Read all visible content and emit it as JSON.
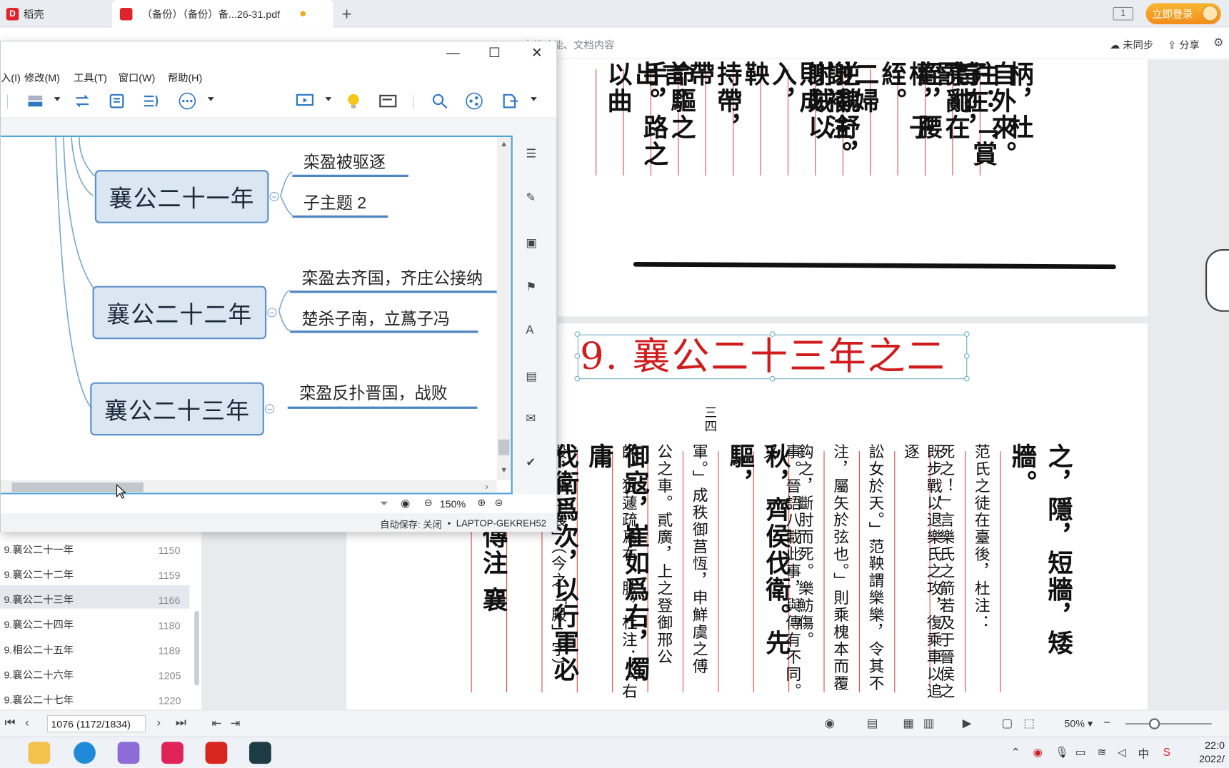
{
  "reader": {
    "home_tab": "稻壳",
    "doc_tab": "（备份）（备份）备...26-31.pdf",
    "login_button": "立即登录",
    "search_hint": "查找功能、文档内容",
    "sync_label": "未同步",
    "share_label": "分享",
    "heading": "9. 襄公二十三年之二",
    "page_input": "1076 (1172/1834)",
    "zoom_level": "50%",
    "toc": [
      {
        "title": "9.襄公二十年",
        "page": "1147"
      },
      {
        "title": "9.襄公二十一年",
        "page": "1150"
      },
      {
        "title": "9.襄公二十二年",
        "page": "1159"
      },
      {
        "title": "9.襄公二十三年",
        "page": "1166"
      },
      {
        "title": "9.襄公二十四年",
        "page": "1180"
      },
      {
        "title": "9.相公二十五年",
        "page": "1189"
      },
      {
        "title": "9.襄公二十六年",
        "page": "1205"
      },
      {
        "title": "9.襄公二十七年",
        "page": "1220"
      }
    ],
    "scan_top": [
      "自外來。",
      "子在",
      "柄，杜注：「賞罰",
      "亮亂在權，子",
      "首巾，絰，腰絰。",
      "二婦",
      "謝補注。",
      "逆魏舒，則成",
      "謝賊以入，",
      "鞅",
      "持帶，",
      "帶",
      "言。",
      "命驅之出。",
      "手，路之以曲"
    ],
    "scan_bottom": [
      "之，隱，短牆，矮牆。",
      "范氏之徒在臺後，杜注：",
      "死之！」言樂氏之箭若及于晉侯之",
      "既步戰以退樂氏之攻，復乘車以追逐",
      "訟女於天。」范鞅謂樂樂，令其不",
      "注，屬矢於弦也。」則乘槐本而覆",
      "鈎之，斷肘而死。樂魴傷。",
      "事。晉語八載此事，與傳有不同。又",
      "秋，齊侯伐衛。先驅，",
      "軍。」成秩御莒恆，申鮮虞之傅",
      "公之車。貳廣，上之登御邢公",
      "師，狼蘧疏爲右，胠，杜注：「右",
      "御寇，崔如爲右，燭庸",
      "殿，卬「展」（今之「殿」字）",
      "伐衛爲次，以行軍必過",
      "春秋左傳注 襄"
    ],
    "page_mark": "三四",
    "clock_time": "22:0",
    "clock_date": "2022/"
  },
  "mindmap": {
    "menus": [
      "入(I)",
      "修改(M)",
      "工具(T)",
      "窗口(W)",
      "帮助(H)"
    ],
    "topics": [
      {
        "label": "襄公二十一年",
        "subs": [
          "栾盈被驱逐",
          "子主题 2"
        ]
      },
      {
        "label": "襄公二十二年",
        "subs": [
          "栾盈去齐国，齐庄公接纳",
          "楚杀子南，立蔿子冯"
        ]
      },
      {
        "label": "襄公二十三年",
        "subs": [
          "栾盈反扑晋国，战败"
        ]
      }
    ],
    "zoom": "150%",
    "autosave": "自动保存: 关闭",
    "computer": "LAPTOP-GEKREH52"
  }
}
